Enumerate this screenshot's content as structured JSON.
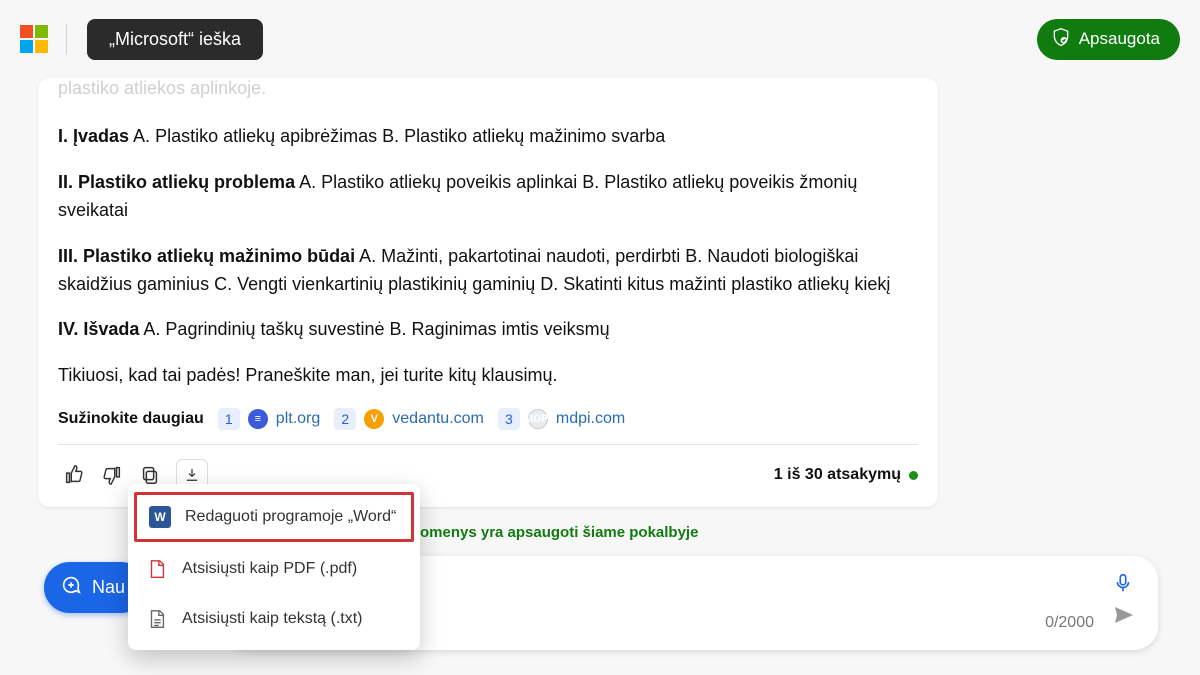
{
  "header": {
    "search_label": "„Microsoft“ ieška",
    "protected_label": "Apsaugota"
  },
  "message": {
    "faded": "plastiko atliekos aplinkoje.",
    "sections": [
      {
        "heading": "I. Įvadas",
        "body": " A. Plastiko atliekų apibrėžimas B. Plastiko atliekų mažinimo svarba"
      },
      {
        "heading": "II. Plastiko atliekų problema",
        "body": " A. Plastiko atliekų poveikis aplinkai B. Plastiko atliekų poveikis žmonių sveikatai"
      },
      {
        "heading": "III. Plastiko atliekų mažinimo būdai",
        "body": " A. Mažinti, pakartotinai naudoti, perdirbti B. Naudoti biologiškai skaidžius gaminius C. Vengti vienkartinių plastikinių gaminių D. Skatinti kitus mažinti plastiko atliekų kiekį"
      },
      {
        "heading": "IV. Išvada",
        "body": " A. Pagrindinių taškų suvestinė B. Raginimas imtis veiksmų"
      }
    ],
    "closing": "Tikiuosi, kad tai padės! Praneškite man, jei turite kitų klausimų.",
    "learn_more_label": "Sužinokite daugiau",
    "refs": [
      {
        "n": "1",
        "host": "plt.org"
      },
      {
        "n": "2",
        "host": "vedantu.com"
      },
      {
        "n": "3",
        "host": "mdpi.com"
      }
    ],
    "counter": "1 iš 30 atsakymų"
  },
  "download_menu": {
    "items": [
      "Redaguoti programoje „Word“",
      "Atsisiųsti kaip PDF (.pdf)",
      "Atsisiųsti kaip tekstą (.txt)"
    ]
  },
  "banner": {
    "protected_text": "omenys yra apsaugoti šiame pokalbyje"
  },
  "compose": {
    "new_topic": "Nau",
    "char_count": "0/2000"
  }
}
